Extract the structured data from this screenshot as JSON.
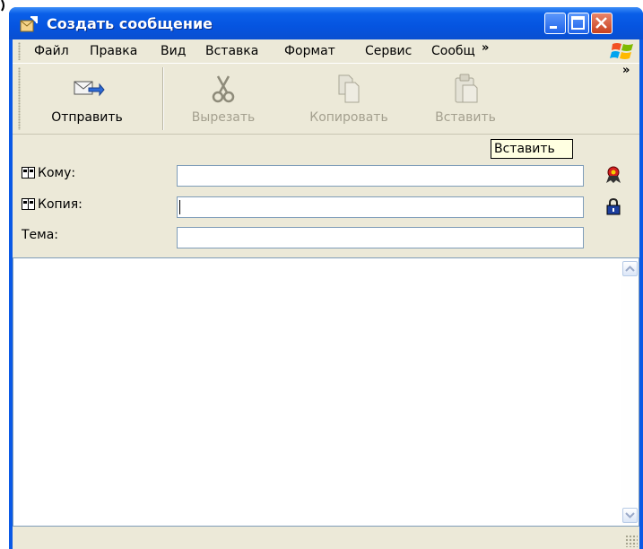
{
  "window": {
    "title": "Создать сообщение"
  },
  "menu": {
    "items": [
      "Файл",
      "Правка",
      "Вид",
      "Вставка",
      "Формат",
      "Сервис",
      "Сообщ"
    ],
    "overflow": "»"
  },
  "toolbar": {
    "send": {
      "label": "Отправить",
      "icon": "send-icon"
    },
    "cut": {
      "label": "Вырезать",
      "icon": "scissors-icon",
      "enabled": false
    },
    "copy": {
      "label": "Копировать",
      "icon": "copy-icon",
      "enabled": false
    },
    "paste": {
      "label": "Вставить",
      "icon": "paste-icon",
      "enabled": false
    },
    "overflow": "»"
  },
  "tooltip": {
    "text": "Вставить"
  },
  "fields": {
    "to": {
      "label": "Кому:",
      "value": ""
    },
    "cc": {
      "label": "Копия:",
      "value": ""
    },
    "subject": {
      "label": "Тема:",
      "value": ""
    }
  },
  "message": {
    "body": ""
  },
  "colors": {
    "titlebar": "#0554e0",
    "client": "#ece9d8",
    "close_button": "#c8401e",
    "tooltip_bg": "#ffffe1"
  }
}
